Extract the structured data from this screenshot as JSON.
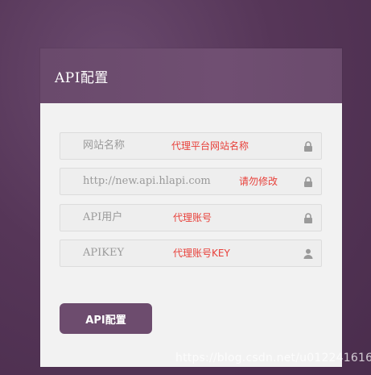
{
  "panel": {
    "title": "API配置"
  },
  "fields": [
    {
      "placeholder": "网站名称",
      "note": "代理平台网站名称",
      "icon": "lock-icon"
    },
    {
      "placeholder": "http://new.api.hlapi.com",
      "note": "请勿修改",
      "icon": "lock-icon"
    },
    {
      "placeholder": "API用户",
      "note": "代理账号",
      "icon": "lock-icon"
    },
    {
      "placeholder": "APIKEY",
      "note": "代理账号KEY",
      "icon": "user-icon"
    }
  ],
  "submit": {
    "label": "API配置"
  },
  "watermark": {
    "text": "https://blog.csdn.net/u012241616"
  },
  "colors": {
    "header": "#6b4b6d",
    "button": "#6d4c6e",
    "note": "#e8403a",
    "background": "#5a3a5e"
  }
}
